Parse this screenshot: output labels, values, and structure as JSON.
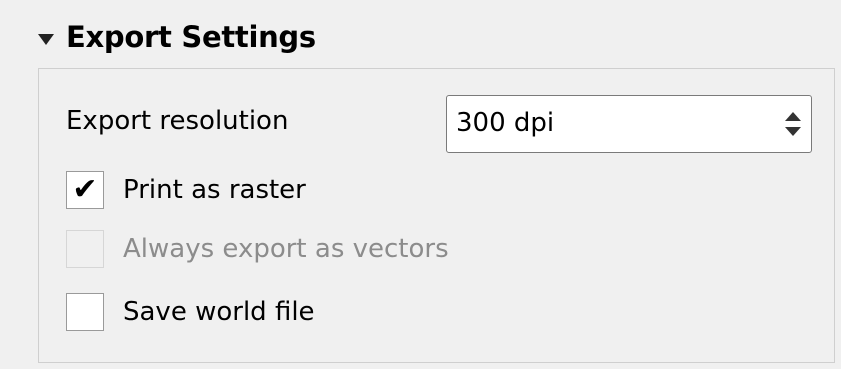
{
  "section": {
    "title": "Export Settings",
    "collapse_icon": "triangle-down-icon",
    "expanded": true
  },
  "resolution": {
    "label": "Export resolution",
    "value": "300 dpi",
    "spin_icons": [
      "arrow-up-icon",
      "arrow-down-icon"
    ]
  },
  "options": [
    {
      "label": "Print as raster",
      "checked": true,
      "enabled": true,
      "check_glyph": "✔"
    },
    {
      "label": "Always export as vectors",
      "checked": false,
      "enabled": false,
      "check_glyph": ""
    },
    {
      "label": "Save world file",
      "checked": false,
      "enabled": true,
      "check_glyph": ""
    }
  ],
  "colors": {
    "background": "#f0f0f0",
    "group_border": "#cfcfcf",
    "disabled_text": "#8c8c8c"
  }
}
